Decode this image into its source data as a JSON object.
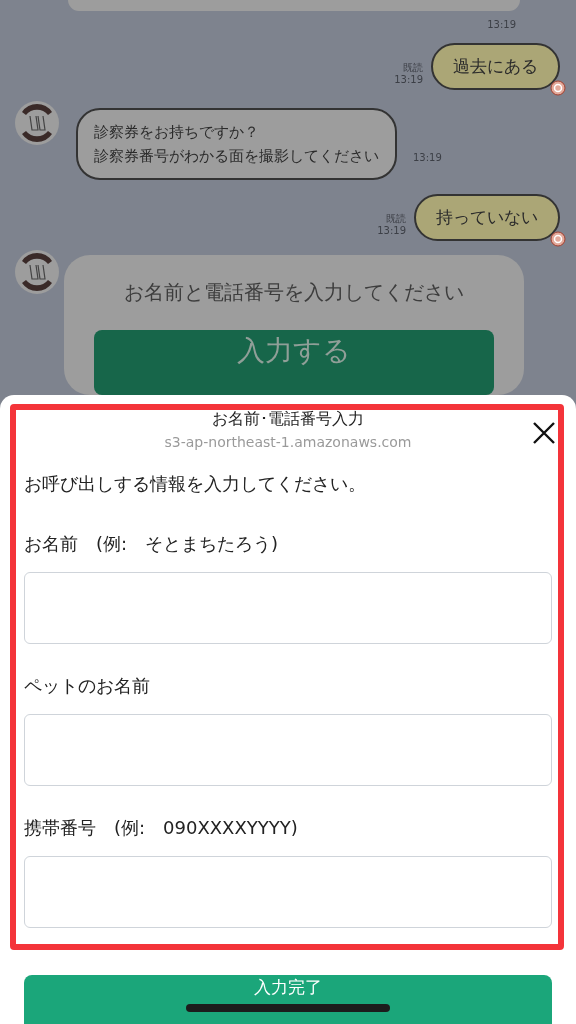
{
  "chat": {
    "messages": [
      {
        "kind": "cut",
        "time": "13:19"
      },
      {
        "kind": "sent",
        "text": "過去にある",
        "read": "既読",
        "time": "13:19"
      },
      {
        "kind": "received",
        "lines": [
          "診察券をお持ちですか？",
          "診察券番号がわかる面を撮影してください"
        ],
        "time": "13:19"
      },
      {
        "kind": "sent",
        "text": "持っていない",
        "read": "既読",
        "time": "13:19"
      },
      {
        "kind": "card",
        "text": "お名前と電話番号を入力してください",
        "button": "入力する"
      }
    ]
  },
  "sheet": {
    "title": "お名前･電話番号入力",
    "url": "s3-ap-northeast-1.amazonaws.com",
    "intro": "お呼び出しする情報を入力してください。",
    "fields": [
      {
        "label": "お名前　(例:　そとまちたろう)"
      },
      {
        "label": "ペットのお名前"
      },
      {
        "label": "携帯番号　(例:　090XXXXYYYY)"
      }
    ],
    "submit": "入力完了"
  }
}
